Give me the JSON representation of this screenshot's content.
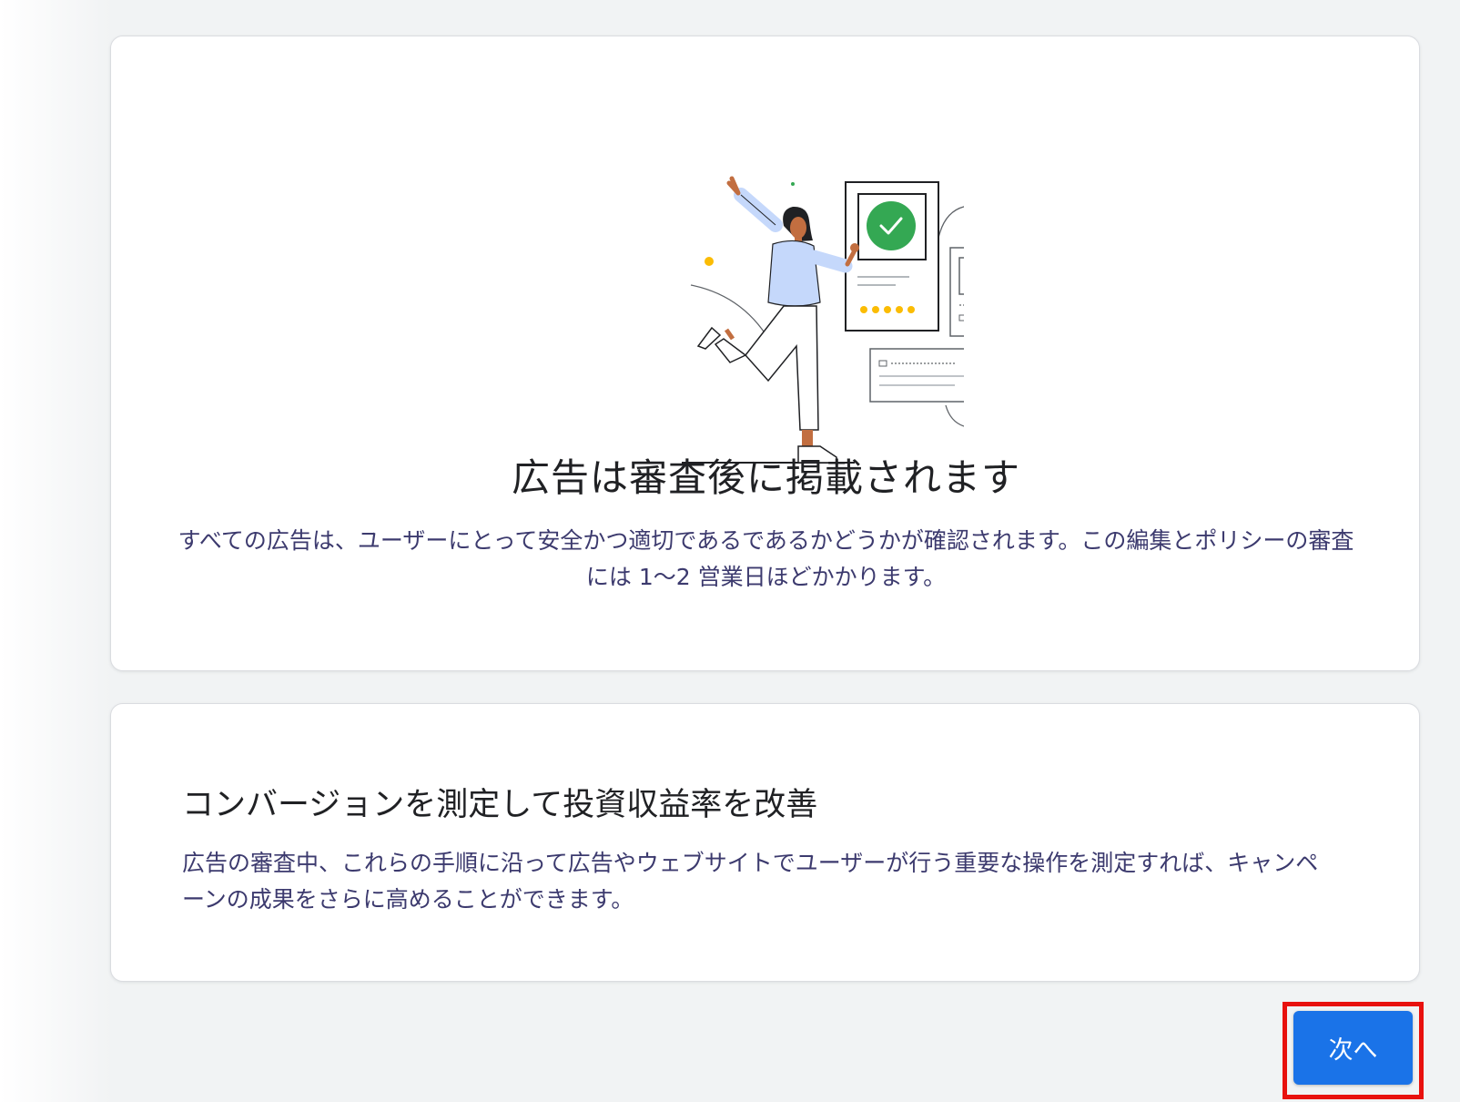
{
  "review_card": {
    "title": "広告は審査後に掲載されます",
    "body": "すべての広告は、ユーザーにとって安全かつ適切であるであるかどうかが確認されます。この編集とポリシーの審査には 1〜2 営業日ほどかかります。"
  },
  "conversion_card": {
    "title": "コンバージョンを測定して投資収益率を改善",
    "body": "広告の審査中、これらの手順に沿って広告やウェブサイトでユーザーが行う重要な操作を測定すれば、キャンペーンの成果をさらに高めることができます。"
  },
  "footer": {
    "next_label": "次へ"
  },
  "colors": {
    "primary_button": "#1a73e8",
    "highlight_border": "#e8110e",
    "check_green": "#34a853",
    "star_yellow": "#fbbc04"
  },
  "icons": {
    "illustration": "celebrating-person-approved-ad-illustration",
    "check": "check-icon",
    "play": "play-icon"
  }
}
